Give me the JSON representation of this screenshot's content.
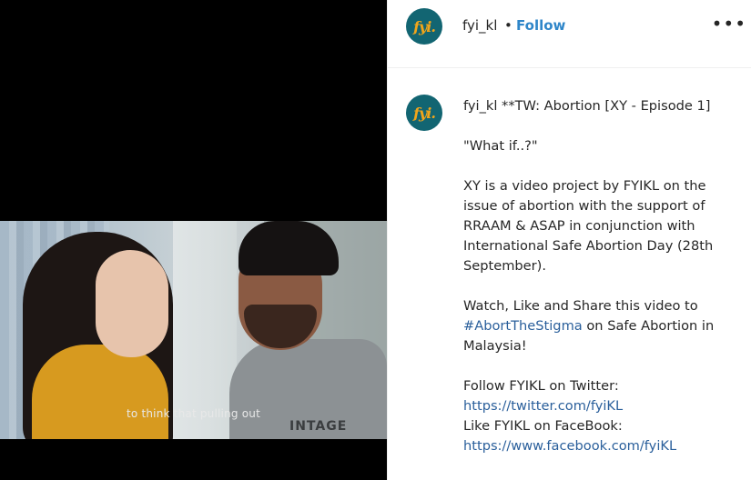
{
  "header": {
    "username": "fyi_kl",
    "separator": "•",
    "follow_label": "Follow",
    "more_label": "•••",
    "avatar_text": "fyi."
  },
  "video": {
    "subtitle": "to think that pulling out",
    "shirt_text": "INTAGE"
  },
  "caption": {
    "username": "fyi_kl",
    "title": "**TW: Abortion [XY - Episode 1]",
    "quote": "\"What if..?\"",
    "description": "XY is a video project by FYIKL on the issue of abortion with the support of RRAAM & ASAP in conjunction with International Safe Abortion Day (28th September).",
    "cta_before": "Watch, Like and Share this video to",
    "hashtag": "#AbortTheStigma",
    "cta_after": "on Safe Abortion in Malaysia!",
    "twitter_label": "Follow FYIKL on Twitter:",
    "twitter_url": "https://twitter.com/fyiKL",
    "facebook_label": "Like FYIKL on FaceBook:",
    "facebook_url": "https://www.facebook.com/fyiKL"
  },
  "colors": {
    "link": "#2a5f9b",
    "follow": "#2f86c9",
    "avatar_bg": "#126572",
    "avatar_text": "#f2a51a"
  }
}
